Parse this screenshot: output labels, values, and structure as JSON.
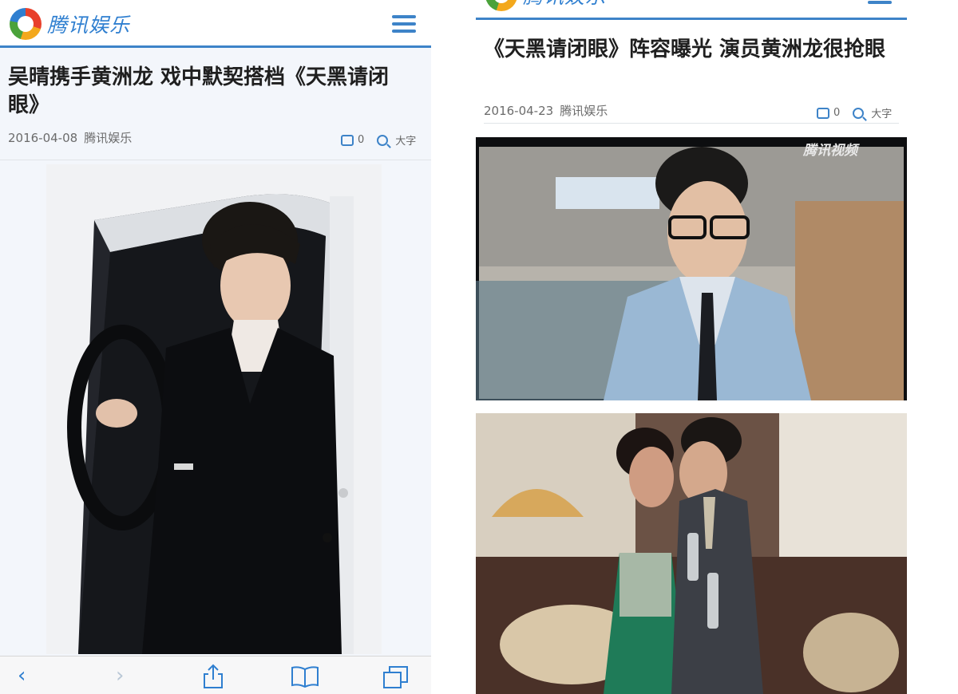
{
  "left": {
    "brand": "腾讯娱乐",
    "headline": "吴晴携手黄洲龙 戏中默契搭档《天黑请闭眼》",
    "date": "2016-04-08",
    "source": "腾讯娱乐",
    "comments": "0",
    "font_size": "大字",
    "toolbar": [
      "back",
      "forward",
      "share",
      "bookmarks",
      "tabs"
    ]
  },
  "right": {
    "brand": "腾讯娱乐",
    "headline": "《天黑请闭眼》阵容曝光 演员黄洲龙很抢眼",
    "date": "2016-04-23",
    "source": "腾讯娱乐",
    "comments": "0",
    "font_size": "大字",
    "video_watermark": "腾讯视频"
  },
  "colors": {
    "accent": "#3d83c8",
    "toolbar_tint": "#2f7fd0"
  },
  "icons": [
    "tencent-logo",
    "hamburger-menu-icon",
    "comment-icon",
    "zoom-icon",
    "back-icon",
    "forward-icon",
    "share-icon",
    "bookmarks-icon",
    "tabs-icon"
  ]
}
